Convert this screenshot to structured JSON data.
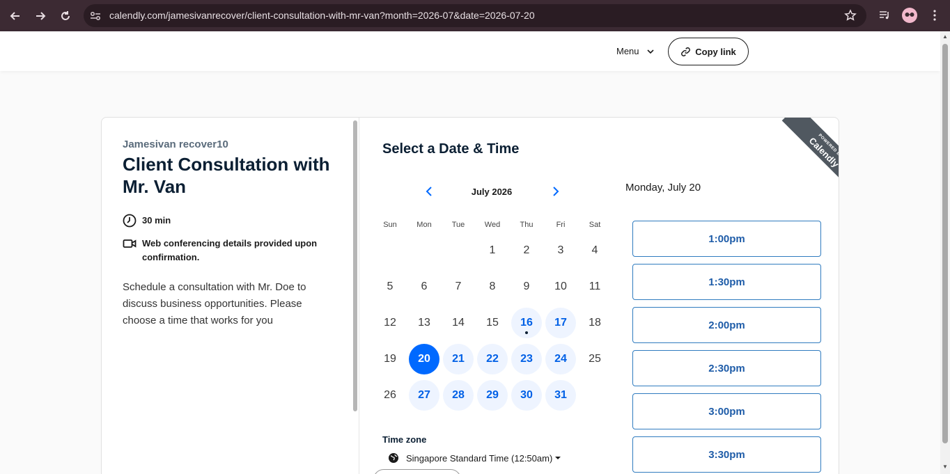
{
  "browser": {
    "url": "calendly.com/jamesivanrecover/client-consultation-with-mr-van?month=2026-07&date=2026-07-20"
  },
  "header": {
    "menu_label": "Menu",
    "copy_link_label": "Copy link"
  },
  "event": {
    "owner": "Jamesivan recover10",
    "title": "Client Consultation with Mr. Van",
    "duration": "30 min",
    "conferencing": "Web conferencing details provided upon confirmation.",
    "description": "Schedule a consultation with Mr. Doe to discuss business opportunities. Please choose a time that works for you"
  },
  "calendar": {
    "heading": "Select a Date & Time",
    "month_label": "July 2026",
    "weekdays": [
      "Sun",
      "Mon",
      "Tue",
      "Wed",
      "Thu",
      "Fri",
      "Sat"
    ],
    "weeks": [
      [
        "",
        "",
        "",
        "1",
        "2",
        "3",
        "4"
      ],
      [
        "5",
        "6",
        "7",
        "8",
        "9",
        "10",
        "11"
      ],
      [
        "12",
        "13",
        "14",
        "15",
        "16",
        "17",
        "18"
      ],
      [
        "19",
        "20",
        "21",
        "22",
        "23",
        "24",
        "25"
      ],
      [
        "26",
        "27",
        "28",
        "29",
        "30",
        "31",
        ""
      ]
    ],
    "available_days": [
      "16",
      "17",
      "21",
      "22",
      "23",
      "24",
      "27",
      "28",
      "29",
      "30",
      "31"
    ],
    "today": "16",
    "selected_day": "20"
  },
  "timezone": {
    "label": "Time zone",
    "value": "Singapore Standard Time (12:50am)"
  },
  "slots": {
    "date_heading": "Monday, July 20",
    "times": [
      "1:00pm",
      "1:30pm",
      "2:00pm",
      "2:30pm",
      "3:00pm",
      "3:30pm"
    ]
  },
  "ribbon": {
    "powered_by": "POWERED BY",
    "brand": "Calendly"
  },
  "colors": {
    "brand_blue": "#0069ff",
    "chrome_bg": "#3c2a33"
  }
}
